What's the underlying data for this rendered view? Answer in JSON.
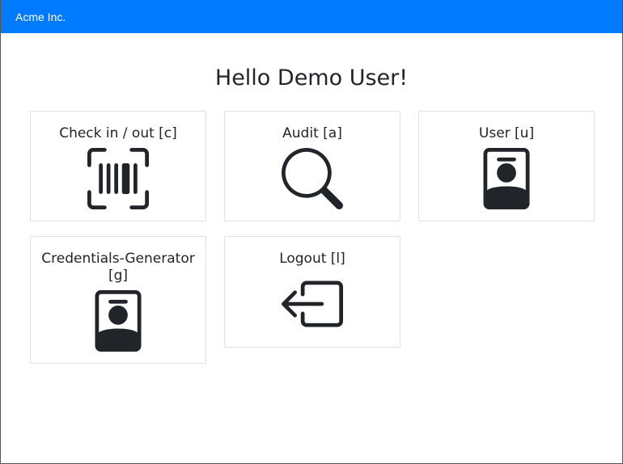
{
  "navbar": {
    "brand": "Acme Inc."
  },
  "page": {
    "title": "Hello Demo User!"
  },
  "tiles": [
    {
      "label": "Check in / out [c]",
      "icon": "barcode-scan-icon"
    },
    {
      "label": "Audit [a]",
      "icon": "magnifier-icon"
    },
    {
      "label": "User [u]",
      "icon": "id-badge-icon"
    },
    {
      "label": "Credentials-Generator [g]",
      "icon": "id-badge-icon"
    },
    {
      "label": "Logout [l]",
      "icon": "logout-arrow-icon"
    }
  ],
  "colors": {
    "navbar": "#007bff",
    "icon": "#212529",
    "border": "#dee2e6"
  }
}
